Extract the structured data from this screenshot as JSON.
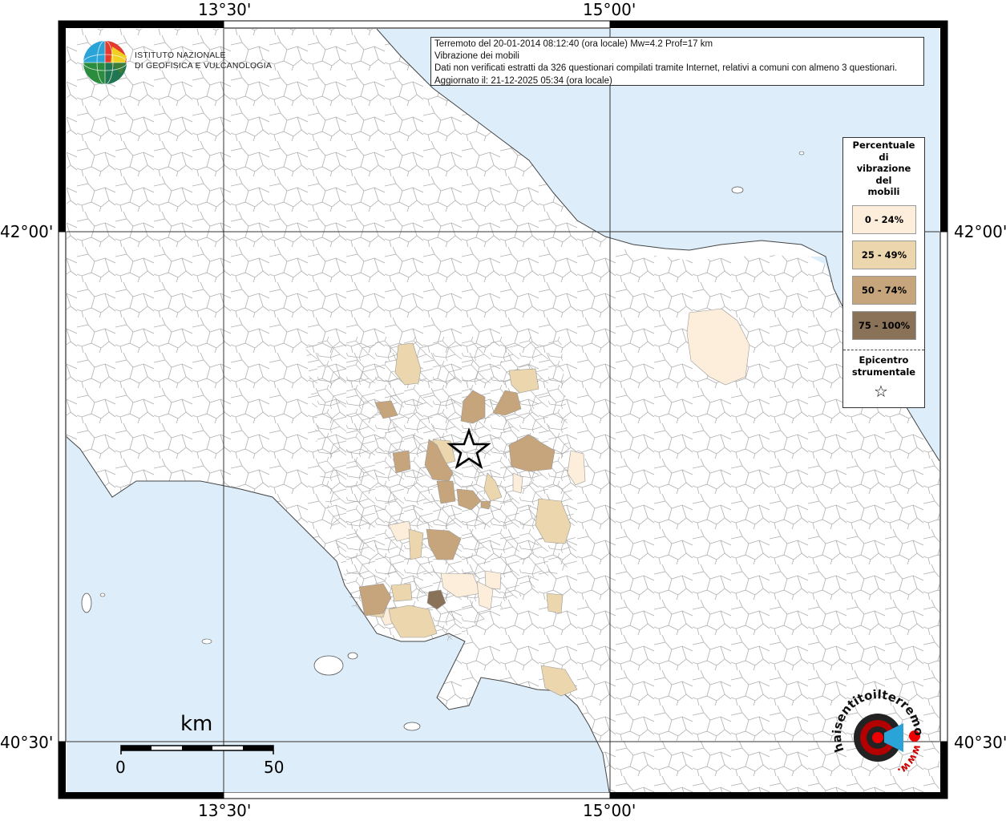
{
  "map": {
    "lon_labels": [
      "13°30'",
      "15°00'"
    ],
    "lat_labels": [
      "42°00'",
      "40°30'"
    ],
    "colors": {
      "sea": "#ddeefa",
      "land": "#ffffff",
      "borders": "#9a9a9a",
      "grid": "#333333",
      "class_0_24": "#fdeedb",
      "class_25_49": "#ecd6ad",
      "class_50_74": "#c6a47c",
      "class_75_100": "#8a7259"
    }
  },
  "info": {
    "line1": "Terremoto del 20-01-2014 08:12:40 (ora locale) Mw=4.2 Prof=17 km",
    "line2": "Vibrazione dei mobili",
    "line3": "Dati non verificati estratti da 326 questionari compilati tramite Internet, relativi a comuni con almeno 3 questionari.",
    "line4": "Aggiornato il: 21-12-2025 05:34 (ora locale)"
  },
  "logo": {
    "line1": "ISTITUTO NAZIONALE",
    "line2": "DI GEOFISICA E VULCANOLOGIA"
  },
  "legend": {
    "title_lines": [
      "Percentuale",
      "di",
      "vibrazione",
      "del",
      "mobili"
    ],
    "classes": [
      {
        "label": "0 - 24%",
        "color": "#fdeedb"
      },
      {
        "label": "25 - 49%",
        "color": "#ecd6ad"
      },
      {
        "label": "50 - 74%",
        "color": "#c6a47c"
      },
      {
        "label": "75 - 100%",
        "color": "#8a7259"
      }
    ],
    "epicenter_lines": [
      "Epicentro",
      "strumentale"
    ],
    "epicenter_symbol": "☆"
  },
  "scale": {
    "unit": "km",
    "start": "0",
    "end": "50"
  },
  "site_logo": {
    "text": "haisentitoilterremoto.it",
    "prefix": "www."
  }
}
